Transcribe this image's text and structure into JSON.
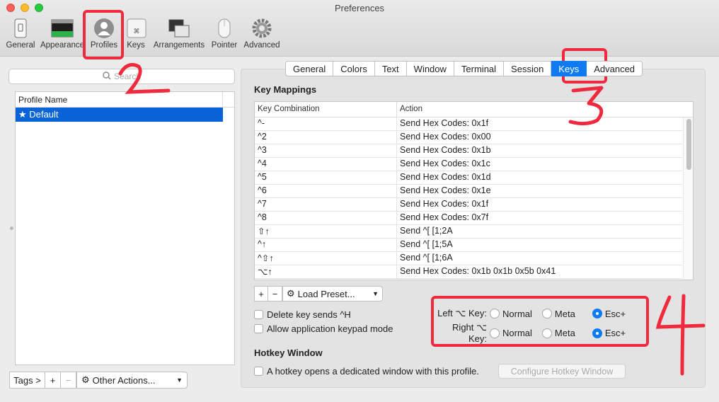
{
  "window": {
    "title": "Preferences"
  },
  "toolbar": [
    {
      "label": "General",
      "icon": "general-icon"
    },
    {
      "label": "Appearance",
      "icon": "appearance-icon"
    },
    {
      "label": "Profiles",
      "icon": "profiles-icon"
    },
    {
      "label": "Keys",
      "icon": "keys-icon"
    },
    {
      "label": "Arrangements",
      "icon": "arrangements-icon"
    },
    {
      "label": "Pointer",
      "icon": "pointer-icon"
    },
    {
      "label": "Advanced",
      "icon": "advanced-gear-icon"
    }
  ],
  "left": {
    "search_placeholder": "Search",
    "table_header": "Profile Name",
    "profiles": [
      "★ Default"
    ],
    "bottom": {
      "tags": "Tags >",
      "add": "+",
      "remove": "−",
      "other_actions": "Other Actions..."
    }
  },
  "tabs": [
    {
      "label": "General"
    },
    {
      "label": "Colors"
    },
    {
      "label": "Text"
    },
    {
      "label": "Window"
    },
    {
      "label": "Terminal"
    },
    {
      "label": "Session"
    },
    {
      "label": "Keys",
      "active": true
    },
    {
      "label": "Advanced"
    }
  ],
  "key_mappings": {
    "title": "Key Mappings",
    "headers": {
      "combo": "Key Combination",
      "action": "Action"
    },
    "rows": [
      {
        "combo": "^-",
        "action": "Send Hex Codes: 0x1f"
      },
      {
        "combo": "^2",
        "action": "Send Hex Codes: 0x00"
      },
      {
        "combo": "^3",
        "action": "Send Hex Codes: 0x1b"
      },
      {
        "combo": "^4",
        "action": "Send Hex Codes: 0x1c"
      },
      {
        "combo": "^5",
        "action": "Send Hex Codes: 0x1d"
      },
      {
        "combo": "^6",
        "action": "Send Hex Codes: 0x1e"
      },
      {
        "combo": "^7",
        "action": "Send Hex Codes: 0x1f"
      },
      {
        "combo": "^8",
        "action": "Send Hex Codes: 0x7f"
      },
      {
        "combo": "⇧↑",
        "action": "Send ^[ [1;2A"
      },
      {
        "combo": "^↑",
        "action": "Send ^[ [1;5A"
      },
      {
        "combo": "^⇧↑",
        "action": "Send ^[ [1;6A"
      },
      {
        "combo": "⌥↑",
        "action": "Send Hex Codes: 0x1b 0x1b 0x5b 0x41"
      }
    ],
    "add": "+",
    "remove": "−",
    "load_preset": "Load Preset..."
  },
  "checkboxes": {
    "delete_key": "Delete key sends ^H",
    "keypad": "Allow application keypad mode",
    "hotkey": "A hotkey opens a dedicated window with this profile."
  },
  "option_keys": {
    "left_label": "Left ⌥ Key:",
    "right_label": "Right ⌥ Key:",
    "choices": [
      "Normal",
      "Meta",
      "Esc+"
    ],
    "left_selected": "Esc+",
    "right_selected": "Esc+"
  },
  "hotkey": {
    "title": "Hotkey Window",
    "button": "Configure Hotkey Window"
  },
  "annotations": {
    "n2": "2",
    "n3": "3",
    "n4": "4"
  },
  "colors": {
    "accent": "#0f7bf2",
    "selection": "#0a64d8",
    "annotation": "#f02a3e"
  }
}
